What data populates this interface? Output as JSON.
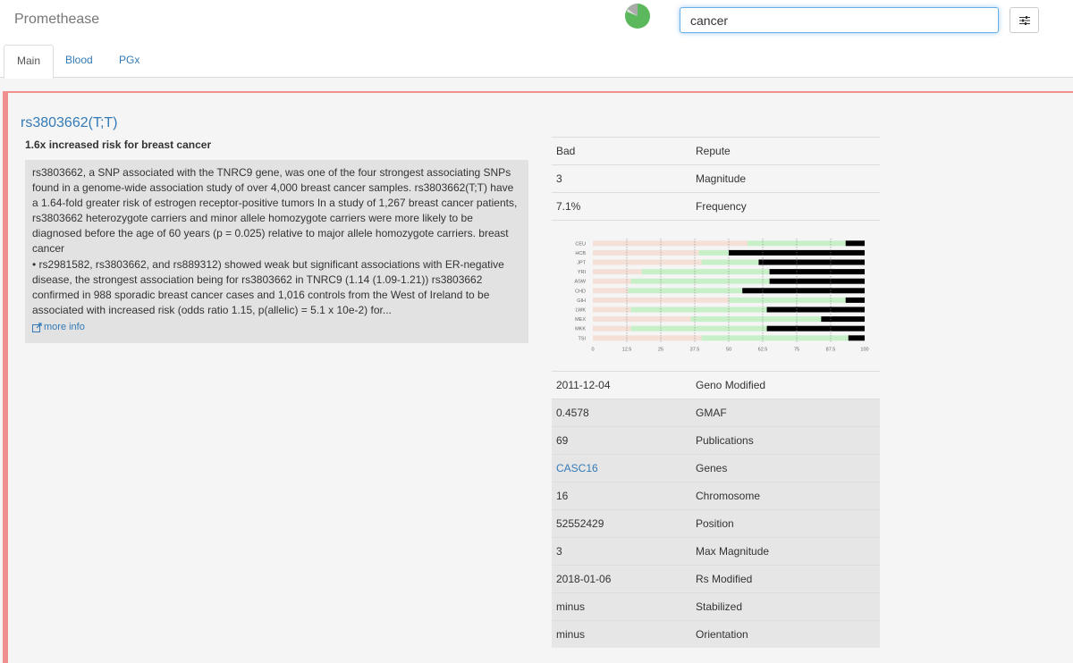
{
  "app": {
    "title": "Promethease"
  },
  "search": {
    "value": "cancer"
  },
  "tabs": [
    {
      "label": "Main"
    },
    {
      "label": "Blood"
    },
    {
      "label": "PGx"
    }
  ],
  "snp": {
    "title": "rs3803662(T;T)",
    "summary": "1.6x increased risk for breast cancer",
    "description_1": "rs3803662, a SNP associated with the TNRC9 gene, was one of the four strongest associating SNPs found in a genome-wide association study of over 4,000 breast cancer samples. rs3803662(T;T) have a 1.64-fold greater risk of estrogen receptor-positive tumors In a study of 1,267 breast cancer patients, rs3803662 heterozygote carriers and minor allele homozygote carriers were more likely to be diagnosed before the age of 60 years (p = 0.025) relative to major allele homozygote carriers. breast cancer",
    "description_2": "• rs2981582, rs3803662, and rs889312) showed weak but significant associations with ER-negative disease, the strongest association being for rs3803662 in TNRC9 (1.14 (1.09-1.21)) rs3803662 confirmed in 988 sporadic breast cancer cases and 1,016 controls from the West of Ireland to be associated with increased risk (odds ratio 1.15, p(allelic) = 5.1 x 10e-2) for...",
    "more_info": "more info"
  },
  "props_top": [
    {
      "value": "Bad",
      "key": "Repute"
    },
    {
      "value": "3",
      "key": "Magnitude"
    },
    {
      "value": "7.1%",
      "key": "Frequency"
    }
  ],
  "props_bottom": [
    {
      "value": "2011-12-04",
      "key": "Geno Modified"
    },
    {
      "value": "0.4578",
      "key": "GMAF"
    },
    {
      "value": "69",
      "key": "Publications"
    },
    {
      "value": "CASC16",
      "key": "Genes"
    },
    {
      "value": "16",
      "key": "Chromosome"
    },
    {
      "value": "52552429",
      "key": "Position"
    },
    {
      "value": "3",
      "key": "Max Magnitude"
    },
    {
      "value": "2018-01-06",
      "key": "Rs Modified"
    },
    {
      "value": "minus",
      "key": "Stabilized"
    },
    {
      "value": "minus",
      "key": "Orientation"
    }
  ],
  "colors": {
    "accent": "#337ab7",
    "panel_border": "#f0908e",
    "homozygous_major": "#f5e0d8",
    "heterozygous": "#c8f0c8",
    "homozygous_minor": "#000000",
    "pie_green": "#5cb85c",
    "pie_grey": "#aaaaaa"
  },
  "chart_data": {
    "type": "bar",
    "stacked": true,
    "orientation": "horizontal",
    "categories": [
      "CEU",
      "HCB",
      "JPT",
      "YRI",
      "ASW",
      "CHD",
      "GIH",
      "LWK",
      "MEX",
      "MKK",
      "TSI"
    ],
    "series": [
      {
        "values": [
          57,
          39,
          40,
          18,
          14,
          13,
          50,
          14,
          36,
          14,
          40
        ]
      },
      {
        "values": [
          36,
          11,
          21,
          47,
          51,
          42,
          43,
          50,
          48,
          50,
          54
        ]
      },
      {
        "values": [
          7,
          50,
          39,
          35,
          35,
          45,
          7,
          36,
          16,
          36,
          6
        ]
      }
    ],
    "xticks": [
      "0",
      "12.5",
      "25",
      "37.5",
      "50",
      "62.5",
      "75",
      "87.5",
      "100"
    ],
    "xlim": [
      0,
      100
    ],
    "grid": true
  }
}
